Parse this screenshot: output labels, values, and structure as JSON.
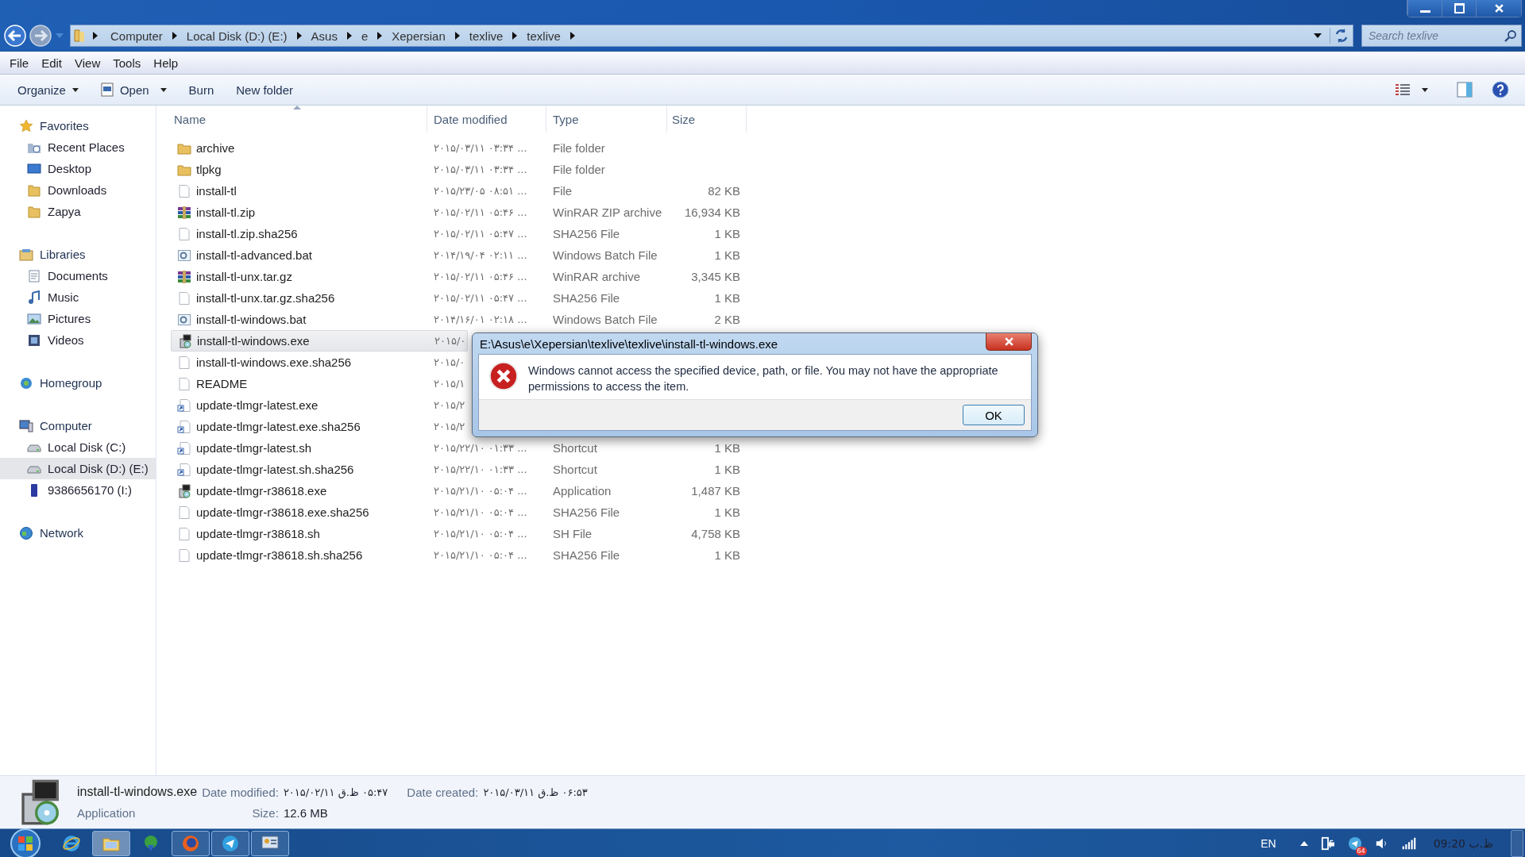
{
  "address_bar": {
    "crumbs": [
      "Computer",
      "Local Disk (D:) (E:)",
      "Asus",
      "e",
      "Xepersian",
      "texlive",
      "texlive"
    ]
  },
  "search": {
    "placeholder": "Search texlive"
  },
  "menu": [
    "File",
    "Edit",
    "View",
    "Tools",
    "Help"
  ],
  "toolbar": [
    {
      "label": "Organize",
      "kind": "dropdown"
    },
    {
      "label": "Open",
      "kind": "open"
    },
    {
      "label": "Burn",
      "kind": "button"
    },
    {
      "label": "New folder",
      "kind": "button"
    }
  ],
  "sidebar": [
    {
      "label": "Favorites",
      "kind": "star",
      "children": [
        {
          "label": "Recent Places",
          "kind": "recent",
          "selected": false
        },
        {
          "label": "Desktop",
          "kind": "desktop",
          "selected": false
        },
        {
          "label": "Downloads",
          "kind": "folder",
          "selected": false
        },
        {
          "label": "Zapya",
          "kind": "folder",
          "selected": false
        }
      ]
    },
    {
      "label": "Libraries",
      "kind": "library",
      "children": [
        {
          "label": "Documents",
          "kind": "documents",
          "selected": false
        },
        {
          "label": "Music",
          "kind": "music",
          "selected": false
        },
        {
          "label": "Pictures",
          "kind": "pictures",
          "selected": false
        },
        {
          "label": "Videos",
          "kind": "videos",
          "selected": false
        }
      ]
    },
    {
      "label": "Homegroup",
      "kind": "homegroup"
    },
    {
      "label": "Computer",
      "kind": "computer",
      "children": [
        {
          "label": "Local Disk (C:)",
          "kind": "drive",
          "selected": false
        },
        {
          "label": "Local Disk (D:) (E:)",
          "kind": "drive",
          "selected": true
        },
        {
          "label": "9386656170 (I:)",
          "kind": "usb",
          "selected": false
        }
      ]
    },
    {
      "label": "Network",
      "kind": "network"
    }
  ],
  "columns": [
    "Name",
    "Date modified",
    "Type",
    "Size"
  ],
  "files": [
    {
      "name": "archive",
      "kind": "folder",
      "date": "۲۰۱۵/۰۳/۱۱ ۰۳:۳۴ ...",
      "type": "File folder",
      "selected": false
    },
    {
      "name": "tlpkg",
      "kind": "folder",
      "date": "۲۰۱۵/۰۳/۱۱ ۰۳:۳۴ ...",
      "type": "File folder",
      "selected": false
    },
    {
      "name": "install-tl",
      "kind": "file",
      "date": "۲۰۱۵/۲۳/۰۵ ۰۸:۵۱ ...",
      "type": "File",
      "size": "82 KB",
      "selected": false
    },
    {
      "name": "install-tl.zip",
      "kind": "archive",
      "date": "۲۰۱۵/۰۲/۱۱ ۰۵:۴۶ ...",
      "type": "WinRAR ZIP archive",
      "size": "16,934 KB",
      "selected": false
    },
    {
      "name": "install-tl.zip.sha256",
      "kind": "file",
      "date": "۲۰۱۵/۰۲/۱۱ ۰۵:۴۷ ...",
      "type": "SHA256 File",
      "size": "1 KB",
      "selected": false
    },
    {
      "name": "install-tl-advanced.bat",
      "kind": "batch",
      "date": "۲۰۱۴/۱۹/۰۴ ۰۲:۱۱ ...",
      "type": "Windows Batch File",
      "size": "1 KB",
      "selected": false
    },
    {
      "name": "install-tl-unx.tar.gz",
      "kind": "archive",
      "date": "۲۰۱۵/۰۲/۱۱ ۰۵:۴۶ ...",
      "type": "WinRAR archive",
      "size": "3,345 KB",
      "selected": false
    },
    {
      "name": "install-tl-unx.tar.gz.sha256",
      "kind": "file",
      "date": "۲۰۱۵/۰۲/۱۱ ۰۵:۴۷ ...",
      "type": "SHA256 File",
      "size": "1 KB",
      "selected": false
    },
    {
      "name": "install-tl-windows.bat",
      "kind": "batch",
      "date": "۲۰۱۴/۱۶/۰۱ ۰۲:۱۸ ...",
      "type": "Windows Batch File",
      "size": "2 KB",
      "selected": false
    },
    {
      "name": "install-tl-windows.exe",
      "kind": "installer",
      "date": "۲۰۱۵/۰",
      "selected": true
    },
    {
      "name": "install-tl-windows.exe.sha256",
      "kind": "file",
      "date": "۲۰۱۵/۰",
      "selected": false
    },
    {
      "name": "README",
      "kind": "file",
      "date": "۲۰۱۵/۱",
      "selected": false
    },
    {
      "name": "update-tlmgr-latest.exe",
      "kind": "shortcut",
      "date": "۲۰۱۵/۲",
      "selected": false
    },
    {
      "name": "update-tlmgr-latest.exe.sha256",
      "kind": "shortcut",
      "date": "۲۰۱۵/۲",
      "selected": false
    },
    {
      "name": "update-tlmgr-latest.sh",
      "kind": "shortcut",
      "date": "۲۰۱۵/۲۲/۱۰ ۰۱:۳۳ ...",
      "type": "Shortcut",
      "size": "1 KB",
      "selected": false
    },
    {
      "name": "update-tlmgr-latest.sh.sha256",
      "kind": "shortcut",
      "date": "۲۰۱۵/۲۲/۱۰ ۰۱:۳۳ ...",
      "type": "Shortcut",
      "size": "1 KB",
      "selected": false
    },
    {
      "name": "update-tlmgr-r38618.exe",
      "kind": "installer",
      "date": "۲۰۱۵/۲۱/۱۰ ۰۵:۰۴ ...",
      "type": "Application",
      "size": "1,487 KB",
      "selected": false
    },
    {
      "name": "update-tlmgr-r38618.exe.sha256",
      "kind": "file",
      "date": "۲۰۱۵/۲۱/۱۰ ۰۵:۰۴ ...",
      "type": "SHA256 File",
      "size": "1 KB",
      "selected": false
    },
    {
      "name": "update-tlmgr-r38618.sh",
      "kind": "file",
      "date": "۲۰۱۵/۲۱/۱۰ ۰۵:۰۴ ...",
      "type": "SH File",
      "size": "4,758 KB",
      "selected": false
    },
    {
      "name": "update-tlmgr-r38618.sh.sha256",
      "kind": "file",
      "date": "۲۰۱۵/۲۱/۱۰ ۰۵:۰۴ ...",
      "type": "SHA256 File",
      "size": "1 KB",
      "selected": false
    }
  ],
  "dialog": {
    "title": "E:\\Asus\\e\\Xepersian\\texlive\\texlive\\install-tl-windows.exe",
    "message": "Windows cannot access the specified device, path, or file.  You may not have the appropriate permissions to access the item.",
    "button": "OK"
  },
  "details": {
    "name": "install-tl-windows.exe",
    "type": "Application",
    "modified_label": "Date modified:",
    "modified": "۲۰۱۵/۰۲/۱۱ ق.ظ ۰۵:۴۷",
    "created_label": "Date created:",
    "created": "۲۰۱۵/۰۳/۱۱ ق.ظ ۰۶:۵۳",
    "size_label": "Size:",
    "size": "12.6 MB"
  },
  "taskbar": {
    "apps": [
      {
        "kind": "ie",
        "running": false,
        "active": false
      },
      {
        "kind": "explorer",
        "running": true,
        "active": true
      },
      {
        "kind": "globe",
        "running": false,
        "active": false
      },
      {
        "kind": "firefox",
        "running": true,
        "active": false
      },
      {
        "kind": "telegram",
        "running": true,
        "active": false
      },
      {
        "kind": "panel",
        "running": true,
        "active": false
      }
    ],
    "language": "EN",
    "badge": "64",
    "clock": "09:20 ب.ظ"
  }
}
